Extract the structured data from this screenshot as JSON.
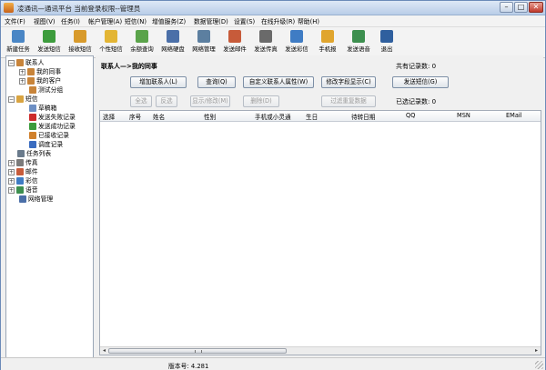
{
  "window": {
    "title": "凌通讯—通讯平台 当前登录权限--管理员",
    "min_glyph": "–",
    "max_glyph": "□",
    "close_glyph": "✕"
  },
  "menu": [
    "文件(F)",
    "视图(V)",
    "任务(I)",
    "帐户管理(A)",
    "短信(N)",
    "增值服务(Z)",
    "数据管理(D)",
    "设置(S)",
    "在线升级(R)",
    "帮助(H)"
  ],
  "toolbar": [
    {
      "label": "新建任务",
      "icon": "new-task-icon",
      "color": "#4a86c5"
    },
    {
      "label": "发送短信",
      "icon": "send-sms-icon",
      "color": "#3d9c3d"
    },
    {
      "label": "接收短信",
      "icon": "receive-sms-icon",
      "color": "#d89a2b"
    },
    {
      "label": "个性短信",
      "icon": "personal-sms-icon",
      "color": "#e3b534"
    },
    {
      "label": "余额查询",
      "icon": "balance-query-icon",
      "color": "#5aa34a"
    },
    {
      "label": "网络硬盘",
      "icon": "network-disk-icon",
      "color": "#4b6fa8"
    },
    {
      "label": "网络管理",
      "icon": "network-manage-icon",
      "color": "#5c7fa0"
    },
    {
      "label": "发送邮件",
      "icon": "send-mail-icon",
      "color": "#c75b3a"
    },
    {
      "label": "发送传真",
      "icon": "send-fax-icon",
      "color": "#6a6a6a"
    },
    {
      "label": "发送彩信",
      "icon": "send-mms-icon",
      "color": "#3f7cc4"
    },
    {
      "label": "手机报",
      "icon": "mobile-news-icon",
      "color": "#e0a52e"
    },
    {
      "label": "发送语音",
      "icon": "send-voice-icon",
      "color": "#3d8f4f"
    },
    {
      "label": "退出",
      "icon": "exit-icon",
      "color": "#2f5f9e"
    }
  ],
  "tree": [
    {
      "label": "联系人",
      "box": "−",
      "icon": "contacts-icon",
      "color": "#c8843a"
    },
    {
      "label": "我的同事",
      "box": "+",
      "icon": "group-icon",
      "color": "#c8843a"
    },
    {
      "label": "我的客户",
      "box": "+",
      "icon": "group-icon",
      "color": "#c8843a"
    },
    {
      "label": "测试分组",
      "box": "",
      "icon": "group-icon",
      "color": "#c8843a"
    },
    {
      "label": "短信",
      "box": "−",
      "icon": "sms-folder-icon",
      "color": "#d9a441"
    },
    {
      "label": "草稿箱",
      "box": "",
      "icon": "draft-icon",
      "color": "#6d8fc4"
    },
    {
      "label": "发送失败记录",
      "box": "",
      "icon": "failed-icon",
      "color": "#cc2b2b"
    },
    {
      "label": "发送成功记录",
      "box": "",
      "icon": "success-icon",
      "color": "#3b9b3b"
    },
    {
      "label": "已接收记录",
      "box": "",
      "icon": "received-icon",
      "color": "#d0802c"
    },
    {
      "label": "调度记录",
      "box": "",
      "icon": "schedule-icon",
      "color": "#3a6cc0"
    },
    {
      "label": "任务列表",
      "box": "",
      "icon": "task-list-icon",
      "color": "#6a7b8c"
    },
    {
      "label": "传真",
      "box": "+",
      "icon": "fax-icon",
      "color": "#7b7b7b"
    },
    {
      "label": "邮件",
      "box": "+",
      "icon": "mail-icon",
      "color": "#c75b3a"
    },
    {
      "label": "彩信",
      "box": "+",
      "icon": "mms-icon",
      "color": "#3f7cc4"
    },
    {
      "label": "语音",
      "box": "+",
      "icon": "voice-icon",
      "color": "#3d8f4f"
    },
    {
      "label": "网络管理",
      "box": "",
      "icon": "network-icon",
      "color": "#4b6fa8"
    }
  ],
  "content": {
    "breadcrumb": "联系人—>我的同事",
    "total_label": "共有记录数: 0",
    "selected_label": "已选记录数: 0",
    "buttons_row1": [
      "增加联系人(L)",
      "查询(Q)",
      "自定义联系人属性(W)",
      "修改字段显示(C)",
      "发送短信(G)"
    ],
    "buttons_row2": [
      "全选",
      "反选",
      "显示/修改(M)",
      "删除(D)",
      "过滤重复数据"
    ],
    "columns": [
      "选择",
      "序号",
      "姓名",
      "性别",
      "手机或小灵通",
      "生日",
      "待转日期",
      "QQ",
      "MSN",
      "EMail"
    ],
    "scroll_left": "◂",
    "scroll_right": "▸"
  },
  "status": {
    "version": "版本号: 4.281"
  }
}
